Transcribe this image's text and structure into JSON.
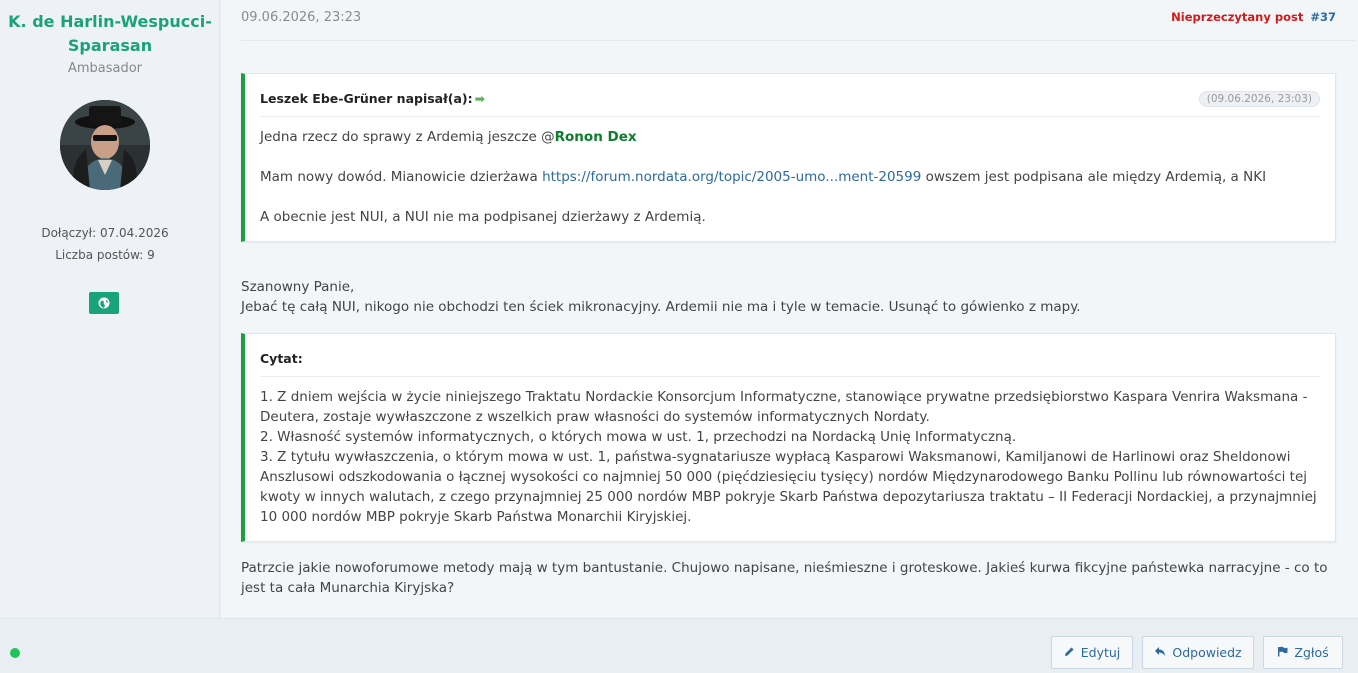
{
  "author": {
    "name": "K. de Harlin-Wespucci-Sparasan",
    "rank": "Ambasador",
    "joined": "Dołączył: 07.04.2026",
    "posts": "Liczba postów: 9",
    "avatar_icon": "avatar-person",
    "website_icon": "globe-icon",
    "status": "online"
  },
  "post": {
    "date": "09.06.2026, 23:23",
    "unread_label": "Nieprzeczytany post",
    "post_number": "#37"
  },
  "quote1": {
    "header": "Leszek Ebe-Grüner napisał(a):",
    "date": "(09.06.2026, 23:03)",
    "line1_prefix": "Jedna rzecz do sprawy z Ardemią jeszcze @",
    "mention": "Ronon Dex",
    "line2_prefix": "Mam nowy dowód. Mianowicie dzierżawa ",
    "link": "https://forum.nordata.org/topic/2005-umo...ment-20599",
    "line2_suffix": " owszem jest podpisana ale między Ardemią, a NKI",
    "line3": "A obecnie jest NUI, a NUI nie ma podpisanej dzierżawy z Ardemią."
  },
  "reply_text": {
    "line1": "Szanowny Panie,",
    "line2": "Jebać tę całą NUI, nikogo nie obchodzi ten ściek mikronacyjny. Ardemii nie ma i tyle w temacie. Usunąć to gówienko z mapy."
  },
  "quote2": {
    "header": "Cytat:",
    "p1": "1. Z dniem wejścia w życie niniejszego Traktatu Nordackie Konsorcjum Informatyczne, stanowiące prywatne przedsiębiorstwo Kaspara Venrira Waksmana - Deutera, zostaje wywłaszczone z wszelkich praw własności do systemów informatycznych Nordaty.",
    "p2": "2. Własność systemów informatycznych, o których mowa w ust. 1, przechodzi na Nordacką Unię Informatyczną.",
    "p3": "3. Z tytułu wywłaszczenia, o którym mowa w ust. 1, państwa-sygnatariusze wypłacą Kasparowi Waksmanowi, Kamiljanowi de Harlinowi oraz Sheldonowi Anszlusowi odszkodowania o łącznej wysokości co najmniej 50 000 (pięćdziesięciu tysięcy) nordów Międzynarodowego Banku Pollinu lub równowartości tej kwoty w innych walutach, z czego przynajmniej 25 000 nordów MBP pokryje Skarb Państwa depozytariusza traktatu – II Federacji Nordackiej, a przynajmniej 10 000 nordów MBP pokryje Skarb Państwa Monarchii Kiryjskiej."
  },
  "closing_text": "Patrzcie jakie nowoforumowe metody mają w tym bantustanie. Chujowo napisane, nieśmieszne i groteskowe. Jakieś kurwa fikcyjne państewka narracyjne - co to jest ta cała Munarchia Kiryjska?",
  "buttons": {
    "edit": "Edytuj",
    "reply": "Odpowiedz",
    "report": "Zgłoś"
  },
  "colors": {
    "accent_green": "#1aa27c",
    "quote_border": "#1e9d41",
    "link": "#2c6aa0",
    "unread": "#d11a1a"
  }
}
